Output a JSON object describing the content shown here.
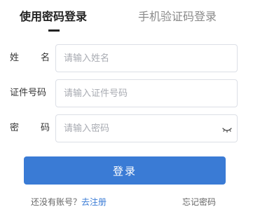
{
  "tabs": {
    "account_login": "使用密码登录",
    "phone_login": "手机验证码登录"
  },
  "form": {
    "name": {
      "label_chars": [
        "姓",
        "名"
      ],
      "placeholder": "请输入姓名"
    },
    "id_number": {
      "label": "证件号码",
      "placeholder": "请输入证件号码"
    },
    "password": {
      "label_chars": [
        "密",
        "码"
      ],
      "placeholder": "请输入密码",
      "toggle_icon": "eye-closed-icon"
    }
  },
  "login_button": "登录",
  "footer": {
    "no_account": "还没有账号？",
    "register": "去注册",
    "forgot_password": "忘记密码"
  },
  "colors": {
    "primary": "#3a7bd5",
    "border": "#dcdfe6",
    "placeholder": "#a8abb2"
  }
}
